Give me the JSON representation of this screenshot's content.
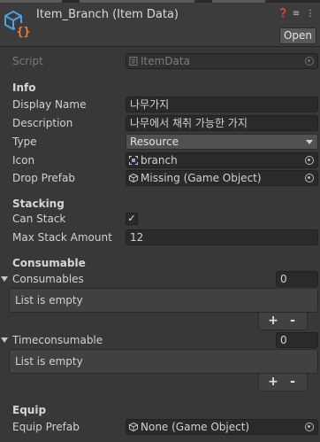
{
  "header": {
    "title": "Item_Branch (Item Data)",
    "open_label": "Open",
    "icons": [
      "script-object-icon",
      "help-icon",
      "preset-icon",
      "more-menu-icon"
    ]
  },
  "script": {
    "label": "Script",
    "value": "ItemData"
  },
  "sections": {
    "info": "Info",
    "stacking": "Stacking",
    "consumable": "Consumable",
    "equip": "Equip"
  },
  "info": {
    "display_name_label": "Display Name",
    "display_name_value": "나무가지",
    "description_label": "Description",
    "description_value": "나무에서 채취 가능한 가지",
    "type_label": "Type",
    "type_value": "Resource",
    "icon_label": "Icon",
    "icon_value": "branch",
    "drop_prefab_label": "Drop Prefab",
    "drop_prefab_value": "Missing (Game Object)"
  },
  "stacking": {
    "can_stack_label": "Can Stack",
    "can_stack_checked": true,
    "check_mark": "✓",
    "max_stack_label": "Max Stack Amount",
    "max_stack_value": "12"
  },
  "consumable": {
    "consumables_label": "Consumables",
    "consumables_count": "0",
    "consumables_empty": "List is empty",
    "timeconsumable_label": "Timeconsumable",
    "timeconsumable_count": "0",
    "timeconsumable_empty": "List is empty",
    "add_symbol": "+",
    "remove_symbol": "-"
  },
  "equip": {
    "equip_prefab_label": "Equip Prefab",
    "equip_prefab_value": "None (Game Object)"
  },
  "colors": {
    "background": "#383838",
    "field": "#2a2a2a",
    "icon_blue": "#4aa3df",
    "icon_orange": "#e8823a"
  }
}
